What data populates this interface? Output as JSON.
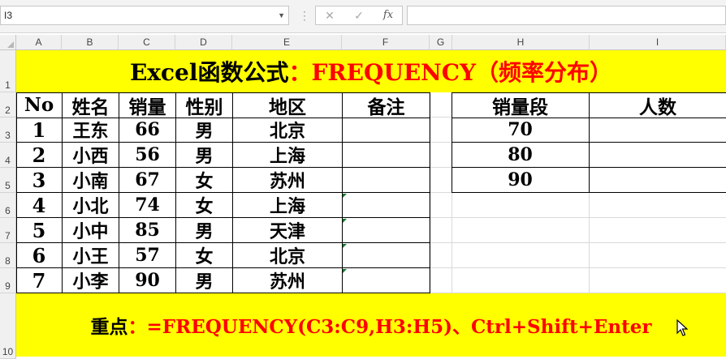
{
  "app": {
    "name_box": "I3",
    "cancel_glyph": "✕",
    "enter_glyph": "✓",
    "fx_label": "fx",
    "formula_text": ""
  },
  "columns": [
    "A",
    "B",
    "C",
    "D",
    "E",
    "F",
    "G",
    "H",
    "I"
  ],
  "rows": [
    "1",
    "2",
    "3",
    "4",
    "5",
    "6",
    "7",
    "8",
    "9",
    "10"
  ],
  "title": {
    "black": "Excel函数公式",
    "red": "：FREQUENCY（频率分布）"
  },
  "table": {
    "headers": [
      "No",
      "姓名",
      "销量",
      "性别",
      "地区",
      "备注"
    ],
    "rows": [
      [
        "1",
        "王东",
        "66",
        "男",
        "北京",
        ""
      ],
      [
        "2",
        "小西",
        "56",
        "男",
        "上海",
        ""
      ],
      [
        "3",
        "小南",
        "67",
        "女",
        "苏州",
        ""
      ],
      [
        "4",
        "小北",
        "74",
        "女",
        "上海",
        ""
      ],
      [
        "5",
        "小中",
        "85",
        "男",
        "天津",
        ""
      ],
      [
        "6",
        "小王",
        "57",
        "女",
        "北京",
        ""
      ],
      [
        "7",
        "小李",
        "90",
        "男",
        "苏州",
        ""
      ]
    ]
  },
  "freq_table": {
    "headers": [
      "销量段",
      "人数"
    ],
    "rows": [
      [
        "70",
        ""
      ],
      [
        "80",
        ""
      ],
      [
        "90",
        ""
      ]
    ]
  },
  "note": {
    "black": "重点",
    "red": "：=FREQUENCY(C3:C9,H3:H5)、Ctrl+Shift+Enter"
  },
  "icons": {
    "namebox_dropdown": "chevron-down-icon",
    "cursor": "mouse-pointer-icon",
    "error_indicator": "green-triangle-icon"
  },
  "colors": {
    "highlight": "#ffff00",
    "accent_text": "#ff0000",
    "error_indicator": "#0a7a2a"
  }
}
